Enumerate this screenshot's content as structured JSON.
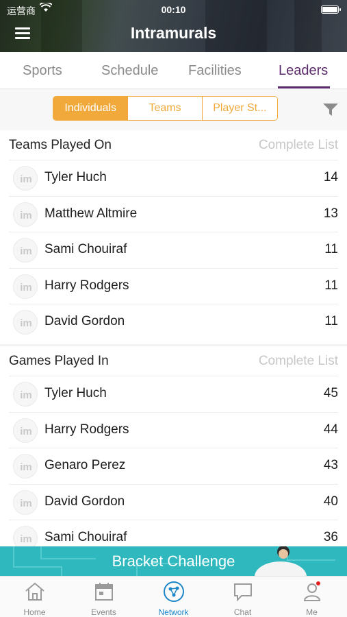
{
  "status_bar": {
    "carrier": "运营商",
    "time": "00:10"
  },
  "header": {
    "title": "Intramurals"
  },
  "tabs": [
    {
      "label": "Sports",
      "active": false
    },
    {
      "label": "Schedule",
      "active": false
    },
    {
      "label": "Facilities",
      "active": false
    },
    {
      "label": "Leaders",
      "active": true
    }
  ],
  "segmented": [
    {
      "label": "Individuals",
      "active": true
    },
    {
      "label": "Teams",
      "active": false
    },
    {
      "label": "Player St...",
      "active": false
    }
  ],
  "sections": [
    {
      "title": "Teams Played On",
      "link": "Complete List",
      "rows": [
        {
          "name": "Tyler Huch",
          "value": "14"
        },
        {
          "name": "Matthew Altmire",
          "value": "13"
        },
        {
          "name": "Sami Chouiraf",
          "value": "11"
        },
        {
          "name": "Harry Rodgers",
          "value": "11"
        },
        {
          "name": "David Gordon",
          "value": "11"
        }
      ]
    },
    {
      "title": "Games Played In",
      "link": "Complete List",
      "rows": [
        {
          "name": "Tyler Huch",
          "value": "45"
        },
        {
          "name": "Harry Rodgers",
          "value": "44"
        },
        {
          "name": "Genaro Perez",
          "value": "43"
        },
        {
          "name": "David Gordon",
          "value": "40"
        },
        {
          "name": "Sami Chouiraf",
          "value": "36"
        }
      ]
    }
  ],
  "banner": {
    "text": "Bracket Challenge"
  },
  "bottom_nav": [
    {
      "label": "Home",
      "icon": "home-icon",
      "active": false
    },
    {
      "label": "Events",
      "icon": "calendar-icon",
      "active": false
    },
    {
      "label": "Network",
      "icon": "network-icon",
      "active": true
    },
    {
      "label": "Chat",
      "icon": "chat-icon",
      "active": false
    },
    {
      "label": "Me",
      "icon": "user-icon",
      "active": false
    }
  ],
  "colors": {
    "accent": "#f0a93a",
    "tab_active": "#5a2a6b",
    "banner": "#2fb8bd",
    "nav_active": "#1d86c9"
  }
}
